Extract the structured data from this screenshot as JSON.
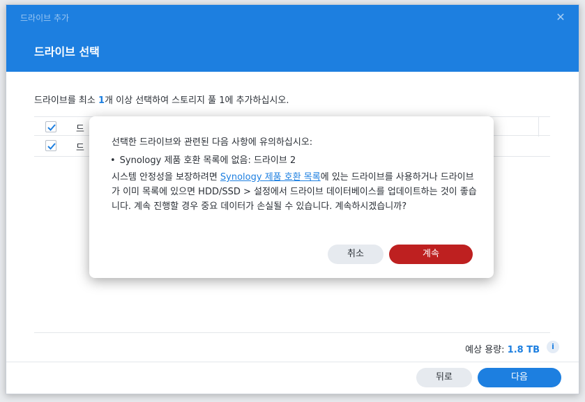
{
  "window": {
    "title": "드라이브 추가",
    "close_glyph": "✕"
  },
  "header": {
    "page_title": "드라이브 선택"
  },
  "instruction": {
    "before": "드라이브를 최소 ",
    "count": "1",
    "after": "개 이상 선택하여 스토리지 풀 1에 추가하십시오."
  },
  "table": {
    "header_label": "드",
    "row_label": "드",
    "header_checked": true,
    "row_checked": true
  },
  "footer": {
    "capacity_label": "예상 용량: ",
    "capacity_value": "1.8 TB",
    "info_glyph": "i",
    "back_label": "뒤로",
    "next_label": "다음"
  },
  "modal": {
    "heading": "선택한 드라이브와 관련된 다음 사항에 유의하십시오:",
    "bullet_dot": "•",
    "bullet_text": "Synology 제품 호환 목록에 없음: 드라이브 2",
    "body_before": "시스템 안정성을 보장하려면 ",
    "body_link": "Synology 제품 호환 목록",
    "body_after": "에 있는 드라이브를 사용하거나 드라이브가 이미 목록에 있으면 HDD/SSD > 설정에서 드라이브 데이터베이스를 업데이트하는 것이 좋습니다. 계속 진행할 경우 중요 데이터가 손실될 수 있습니다. 계속하시겠습니까?",
    "cancel_label": "취소",
    "continue_label": "계속"
  },
  "colors": {
    "accent": "#1d7fe0",
    "danger": "#be2020"
  }
}
